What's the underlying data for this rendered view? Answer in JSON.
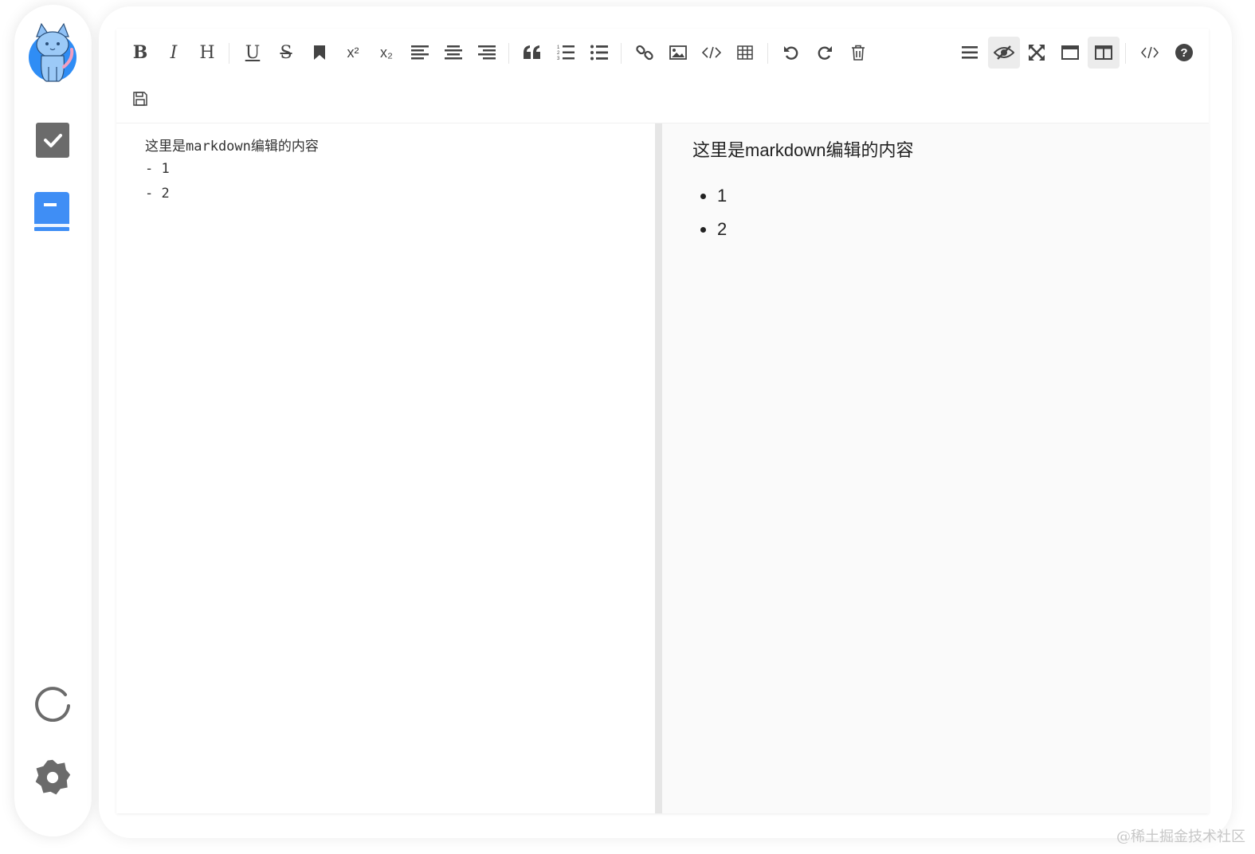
{
  "sidebar": {
    "items": [
      {
        "icon": "avatar-cat-logo"
      },
      {
        "icon": "checkbox-icon",
        "color": "#6b6b6b"
      },
      {
        "icon": "book-icon",
        "color": "#3f8ef5"
      },
      {
        "icon": "refresh-spinner-icon"
      },
      {
        "icon": "settings-gear-icon"
      }
    ]
  },
  "toolbar": {
    "bold": "B",
    "italic": "I",
    "heading": "H",
    "underline": "U",
    "strike": "S",
    "superscript": "x²",
    "subscript": "x₂",
    "icons": [
      "bold-icon",
      "italic-icon",
      "heading-icon",
      "underline-icon",
      "strikethrough-icon",
      "bookmark-icon",
      "superscript-icon",
      "subscript-icon",
      "align-left-icon",
      "align-center-icon",
      "align-right-icon",
      "quote-icon",
      "ordered-list-icon",
      "unordered-list-icon",
      "link-icon",
      "image-icon",
      "code-icon",
      "table-icon",
      "undo-icon",
      "redo-icon",
      "trash-icon",
      "navigation-icon",
      "preview-toggle-icon",
      "fullscreen-icon",
      "fullscreen-window-icon",
      "split-view-icon",
      "html-code-icon",
      "help-icon",
      "save-icon"
    ],
    "active": [
      "preview-toggle",
      "split-view"
    ]
  },
  "editor": {
    "source_lines": [
      "这里是markdown编辑的内容",
      "- 1",
      "- 2"
    ]
  },
  "preview": {
    "paragraph": "这里是markdown编辑的内容",
    "list_items": [
      "1",
      "2"
    ]
  },
  "colors": {
    "accent": "#3f8ef5",
    "icon": "#444444",
    "active_bg": "#ececec"
  },
  "watermark": "@稀土掘金技术社区"
}
